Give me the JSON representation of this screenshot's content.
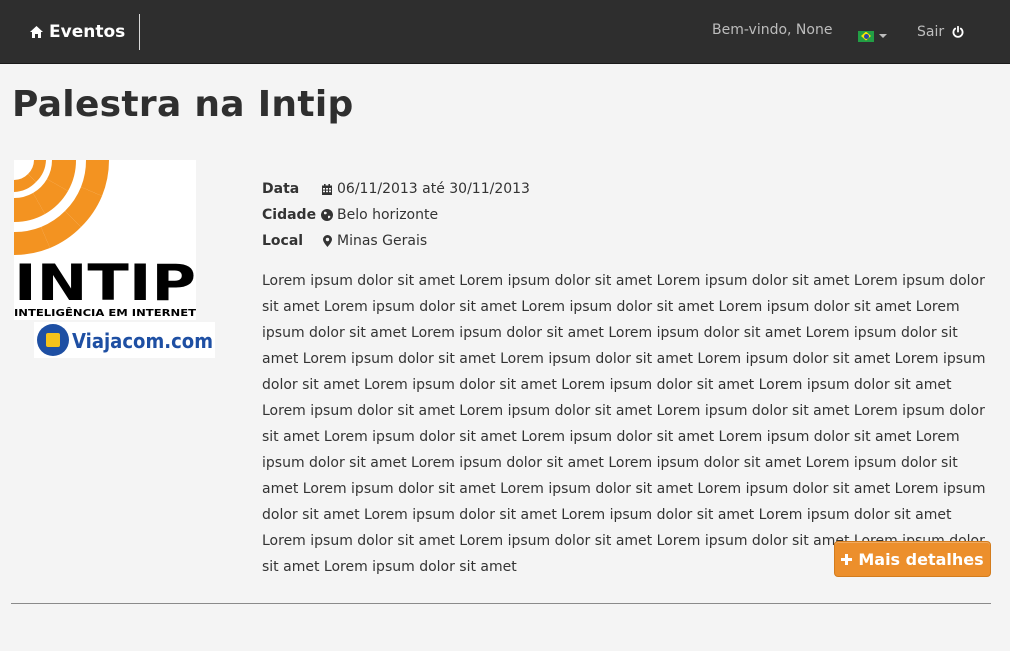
{
  "navbar": {
    "brand": "Eventos",
    "welcome": "Bem-vindo, None",
    "language_flag": "brazil-flag",
    "logout": "Sair"
  },
  "event": {
    "title": "Palestra na Intip",
    "logo": {
      "wordmark": "INTIP",
      "tagline": "INTELIGÊNCIA EM INTERNET",
      "sponsor": "Viajacom.com"
    },
    "details": [
      {
        "label": "Data",
        "icon": "calendar-icon",
        "value": "06/11/2013 até 30/11/2013"
      },
      {
        "label": "Cidade",
        "icon": "globe-icon",
        "value": "Belo horizonte"
      },
      {
        "label": "Local",
        "icon": "map-marker-icon",
        "value": "Minas Gerais"
      }
    ],
    "description": "Lorem ipsum dolor sit amet Lorem ipsum dolor sit amet Lorem ipsum dolor sit amet Lorem ipsum dolor sit amet Lorem ipsum dolor sit amet Lorem ipsum dolor sit amet Lorem ipsum dolor sit amet Lorem ipsum dolor sit amet Lorem ipsum dolor sit amet Lorem ipsum dolor sit amet Lorem ipsum dolor sit amet Lorem ipsum dolor sit amet Lorem ipsum dolor sit amet Lorem ipsum dolor sit amet Lorem ipsum dolor sit amet Lorem ipsum dolor sit amet Lorem ipsum dolor sit amet Lorem ipsum dolor sit amet Lorem ipsum dolor sit amet Lorem ipsum dolor sit amet Lorem ipsum dolor sit amet Lorem ipsum dolor sit amet Lorem ipsum dolor sit amet Lorem ipsum dolor sit amet Lorem ipsum dolor sit amet Lorem ipsum dolor sit amet Lorem ipsum dolor sit amet Lorem ipsum dolor sit amet Lorem ipsum dolor sit amet Lorem ipsum dolor sit amet Lorem ipsum dolor sit amet Lorem ipsum dolor sit amet Lorem ipsum dolor sit amet Lorem ipsum dolor sit amet Lorem ipsum dolor sit amet Lorem ipsum dolor sit amet Lorem ipsum dolor sit amet Lorem ipsum dolor sit amet Lorem ipsum dolor sit amet Lorem ipsum dolor sit amet Lorem ipsum dolor sit amet",
    "more_button": "Mais detalhes"
  },
  "colors": {
    "navbar": "#2e2e2e",
    "accent": "#ec8f2c",
    "logo_orange": "#f39321",
    "sponsor_blue": "#1e4fa3"
  }
}
